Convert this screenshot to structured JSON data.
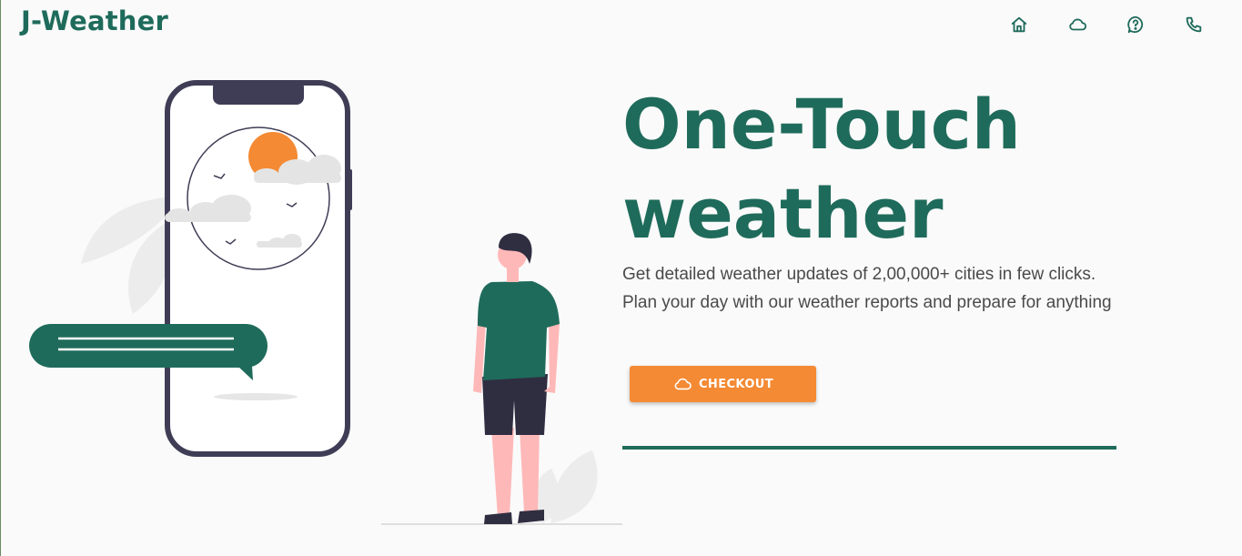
{
  "brand": {
    "name": "J-Weather"
  },
  "nav": {
    "items": [
      {
        "icon": "home-icon"
      },
      {
        "icon": "cloud-icon"
      },
      {
        "icon": "help-icon"
      },
      {
        "icon": "phone-icon"
      }
    ]
  },
  "hero": {
    "title": "One-Touch weather",
    "description": "Get detailed weather updates of 2,00,000+ cities in few clicks. Plan your day with our weather reports and prepare for anything",
    "cta_label": "CHECKOUT",
    "cta_icon": "cloud-icon"
  },
  "colors": {
    "primary": "#1f6b5b",
    "accent": "#f48a34",
    "background": "#fafafa",
    "text": "#4a4a4a"
  }
}
